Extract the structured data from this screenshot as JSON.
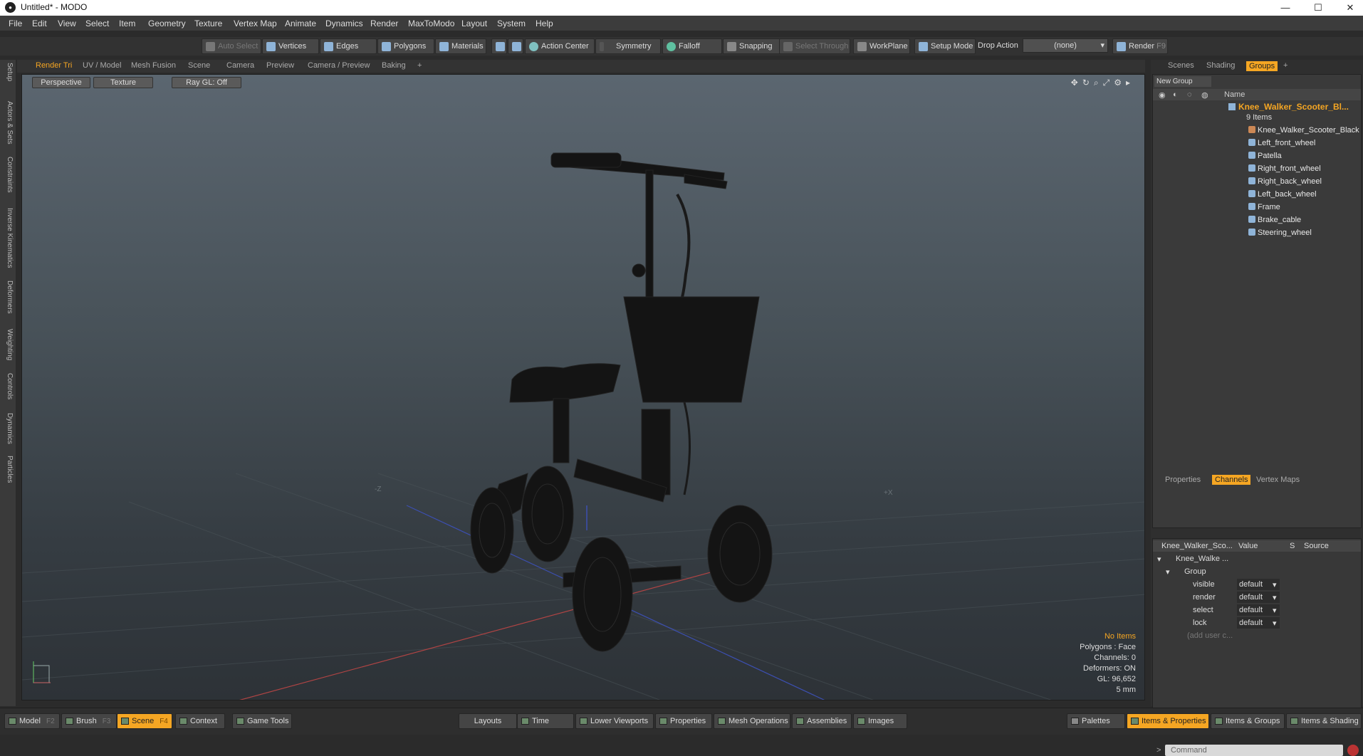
{
  "app": {
    "window_title": "Untitled* - MODO"
  },
  "menu": [
    "File",
    "Edit",
    "View",
    "Select",
    "Item",
    "Geometry",
    "Texture",
    "Vertex Map",
    "Animate",
    "Dynamics",
    "Render",
    "MaxToModo",
    "Layout",
    "System",
    "Help"
  ],
  "toolbar": {
    "auto_select": "Auto Select",
    "vertices": "Vertices",
    "edges": "Edges",
    "polygons": "Polygons",
    "materials": "Materials",
    "action_center": "Action Center",
    "symmetry": "Symmetry",
    "falloff": "Falloff",
    "snapping": "Snapping",
    "select_through": "Select Through",
    "workplane": "WorkPlane",
    "setup_mode": "Setup Mode",
    "drop_action": "Drop Action",
    "drop_action_value": "(none)",
    "render": "Render",
    "render_key": "F9"
  },
  "left_tabs": [
    "Setup",
    "Actors & Sets",
    "Constraints",
    "Inverse Kinematics",
    "Deformers",
    "Weighting",
    "Controls",
    "Dynamics",
    "Particles"
  ],
  "viewport_tabs": [
    "Render Tri",
    "UV / Model",
    "Mesh Fusion",
    "Scene",
    "Camera",
    "Preview",
    "Camera / Preview",
    "Baking"
  ],
  "viewport": {
    "view_mode": "Perspective",
    "shading": "Texture",
    "raygl": "Ray GL: Off",
    "axis_z": "-Z",
    "axis_x": "+X",
    "info": {
      "selection": "No Items",
      "polygons": "Polygons : Face",
      "channels": "Channels: 0",
      "deformers": "Deformers: ON",
      "gl": "GL: 96,652",
      "unit": "5 mm"
    }
  },
  "right_tabs": [
    "Scenes",
    "Shading",
    "Groups"
  ],
  "groups": {
    "new_group": "New Group",
    "name_header": "Name",
    "root": "Knee_Walker_Scooter_Bl...",
    "count": "9 Items",
    "items": [
      "Knee_Walker_Scooter_Black",
      "Left_front_wheel",
      "Patella",
      "Right_front_wheel",
      "Right_back_wheel",
      "Left_back_wheel",
      "Frame",
      "Brake_cable",
      "Steering_wheel"
    ]
  },
  "channel_tabs": [
    "Properties",
    "Channels",
    "Vertex Maps"
  ],
  "channels": {
    "col_name": "Knee_Walker_Sco...",
    "col_value": "Value",
    "col_s": "S",
    "col_source": "Source",
    "item": "Knee_Walke ...",
    "group": "Group",
    "rows": [
      {
        "name": "visible",
        "value": "default"
      },
      {
        "name": "render",
        "value": "default"
      },
      {
        "name": "select",
        "value": "default"
      },
      {
        "name": "lock",
        "value": "default"
      }
    ],
    "add_user": "(add user c..."
  },
  "command_placeholder": "Command",
  "bottom": {
    "model": "Model",
    "model_key": "F2",
    "brush": "Brush",
    "brush_key": "F3",
    "scene": "Scene",
    "scene_key": "F4",
    "context": "Context",
    "game_tools": "Game Tools",
    "layouts": "Layouts",
    "time": "Time",
    "lower_viewports": "Lower Viewports",
    "properties": "Properties",
    "mesh_operations": "Mesh Operations",
    "assemblies": "Assemblies",
    "images": "Images",
    "palettes": "Palettes",
    "items_properties": "Items & Properties",
    "items_groups": "Items & Groups",
    "items_shading": "Items & Shading"
  },
  "colors": {
    "accent": "#f5a623",
    "panel": "#2f2f2f",
    "viewport_top": "#5b6670",
    "viewport_bottom": "#2d3237"
  }
}
